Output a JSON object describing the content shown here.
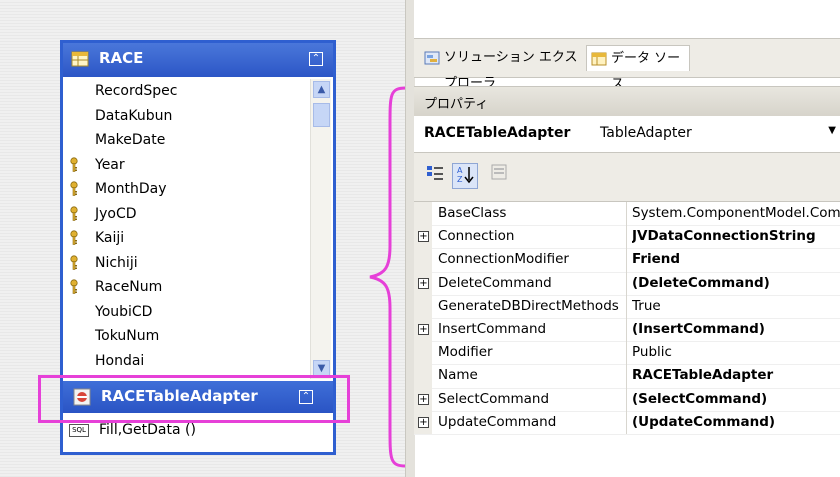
{
  "table": {
    "title": "RACE",
    "fields": [
      {
        "name": "RecordSpec",
        "key": false
      },
      {
        "name": "DataKubun",
        "key": false
      },
      {
        "name": "MakeDate",
        "key": false
      },
      {
        "name": "Year",
        "key": true
      },
      {
        "name": "MonthDay",
        "key": true
      },
      {
        "name": "JyoCD",
        "key": true
      },
      {
        "name": "Kaiji",
        "key": true
      },
      {
        "name": "Nichiji",
        "key": true
      },
      {
        "name": "RaceNum",
        "key": true
      },
      {
        "name": "YoubiCD",
        "key": false
      },
      {
        "name": "TokuNum",
        "key": false
      },
      {
        "name": "Hondai",
        "key": false
      }
    ]
  },
  "adapter": {
    "title": "RACETableAdapter",
    "method": "Fill,GetData ()",
    "sql_badge": "SQL"
  },
  "tabs": {
    "solution_explorer": "ソリューション エクスプローラ",
    "data_sources": "データ ソース"
  },
  "properties": {
    "title": "プロパティ",
    "object_name": "RACETableAdapter",
    "object_type": "TableAdapter",
    "rows": [
      {
        "name": "BaseClass",
        "value": "System.ComponentModel.Component",
        "expandable": false,
        "bold": false
      },
      {
        "name": "Connection",
        "value": "JVDataConnectionString",
        "expandable": true,
        "bold": true
      },
      {
        "name": "ConnectionModifier",
        "value": "Friend",
        "expandable": false,
        "bold": true
      },
      {
        "name": "DeleteCommand",
        "value": "(DeleteCommand)",
        "expandable": true,
        "bold": true
      },
      {
        "name": "GenerateDBDirectMethods",
        "value": "True",
        "expandable": false,
        "bold": false
      },
      {
        "name": "InsertCommand",
        "value": "(InsertCommand)",
        "expandable": true,
        "bold": true
      },
      {
        "name": "Modifier",
        "value": "Public",
        "expandable": false,
        "bold": false
      },
      {
        "name": "Name",
        "value": "RACETableAdapter",
        "expandable": false,
        "bold": true
      },
      {
        "name": "SelectCommand",
        "value": "(SelectCommand)",
        "expandable": true,
        "bold": true
      },
      {
        "name": "UpdateCommand",
        "value": "(UpdateCommand)",
        "expandable": true,
        "bold": true
      }
    ]
  },
  "colors": {
    "table_header": "#2c56c6",
    "highlight": "#e640d8"
  }
}
